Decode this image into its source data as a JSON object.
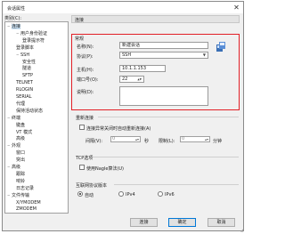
{
  "dialog": {
    "title": "会话属性",
    "close_glyph": "✕"
  },
  "tree": {
    "label": "类别(C):",
    "items": [
      {
        "label": "连接",
        "level": 0,
        "toggle": "−"
      },
      {
        "label": "用户身份验证",
        "level": 1,
        "toggle": "−"
      },
      {
        "label": "登录提示符",
        "level": 2
      },
      {
        "label": "登录脚本",
        "level": 1
      },
      {
        "label": "SSH",
        "level": 1,
        "toggle": "−"
      },
      {
        "label": "安全性",
        "level": 2
      },
      {
        "label": "隧道",
        "level": 2
      },
      {
        "label": "SFTP",
        "level": 2
      },
      {
        "label": "TELNET",
        "level": 1
      },
      {
        "label": "RLOGIN",
        "level": 1
      },
      {
        "label": "SERIAL",
        "level": 1
      },
      {
        "label": "代理",
        "level": 1
      },
      {
        "label": "保持活动状态",
        "level": 1
      },
      {
        "label": "终端",
        "level": 0,
        "toggle": "−"
      },
      {
        "label": "键盘",
        "level": 1
      },
      {
        "label": "VT 模式",
        "level": 1
      },
      {
        "label": "高级",
        "level": 1
      },
      {
        "label": "外观",
        "level": 0,
        "toggle": "−"
      },
      {
        "label": "窗口",
        "level": 1
      },
      {
        "label": "突出",
        "level": 1
      },
      {
        "label": "高级",
        "level": 0,
        "toggle": "−"
      },
      {
        "label": "跟踪",
        "level": 1
      },
      {
        "label": "响铃",
        "level": 1
      },
      {
        "label": "日志记录",
        "level": 1
      },
      {
        "label": "文件传输",
        "level": 0,
        "toggle": "−"
      },
      {
        "label": "X/YMODEM",
        "level": 1
      },
      {
        "label": "ZMODEM",
        "level": 1
      }
    ]
  },
  "panel": {
    "header": "连接",
    "section": "常规",
    "fields": {
      "name_label": "名称(N):",
      "name_value": "新建会话",
      "protocol_label": "协议(P):",
      "protocol_value": "SSH",
      "host_label": "主机(H):",
      "host_value": "10.1.1.153",
      "port_label": "端口号(O):",
      "port_value": "22",
      "desc_label": "说明(D):",
      "desc_value": ""
    }
  },
  "reconnect": {
    "title": "重新连接",
    "checkbox_label": "连接异常关闭时自动重新连接(A)",
    "interval_label": "间隔(V):",
    "interval_value": "0",
    "interval_unit": "秒",
    "limit_label": "限制(L):",
    "limit_value": "0",
    "limit_unit": "分钟"
  },
  "tcp": {
    "title": "TCP选项",
    "checkbox_label": "使用Nagle算法(U)"
  },
  "ip_version": {
    "title": "互联网协议版本",
    "options": [
      "自动",
      "IPv4",
      "IPv6"
    ],
    "selected": 0
  },
  "buttons": {
    "connect": "连接",
    "ok": "确定",
    "cancel": "取消"
  },
  "colors": {
    "highlight_border": "#e21f26",
    "selection": "#cce4f7"
  }
}
